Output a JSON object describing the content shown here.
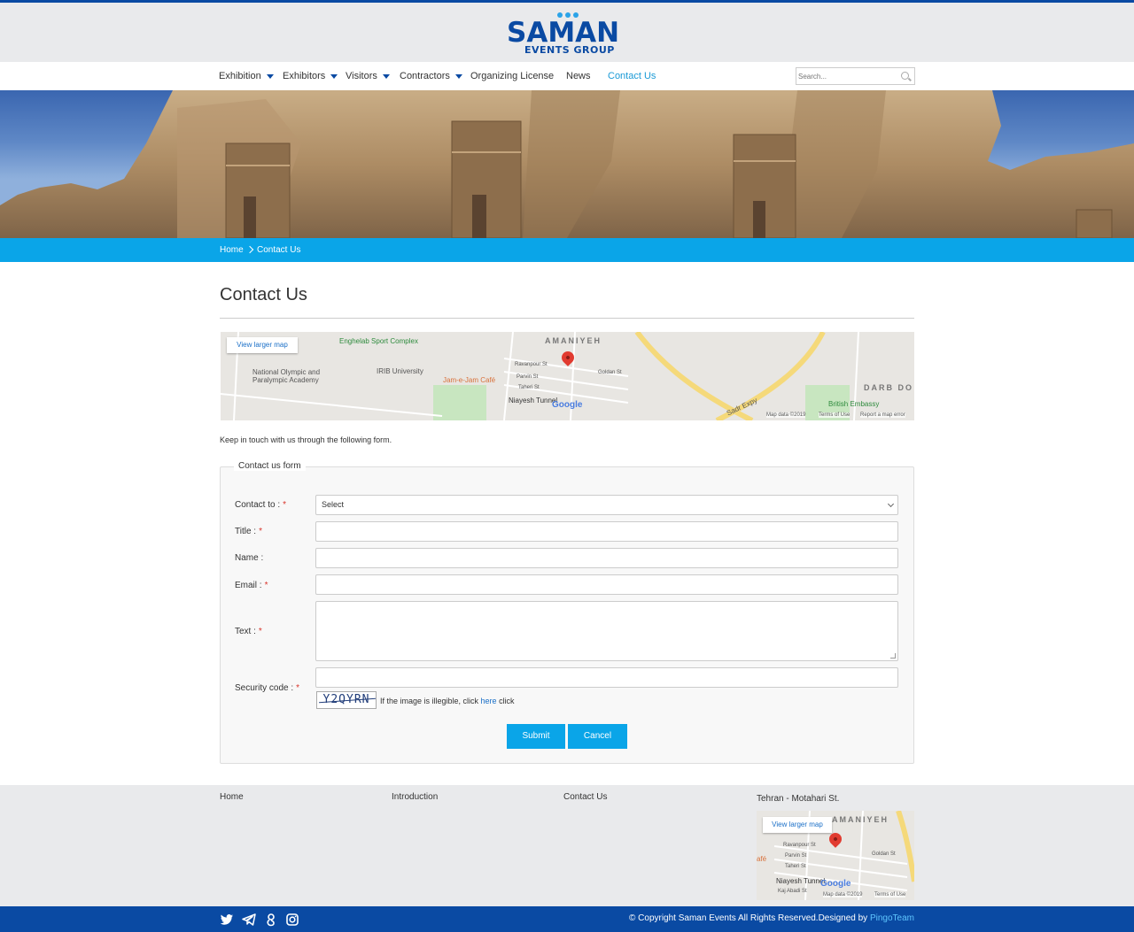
{
  "brand": {
    "name": "SAMAN",
    "sub": "EVENTS GROUP",
    "primary": "#0a4aa3",
    "accent": "#0aa5e8"
  },
  "nav": {
    "items": [
      {
        "label": "Exhibition"
      },
      {
        "label": "Exhibitors"
      },
      {
        "label": "Visitors"
      },
      {
        "label": "Contractors"
      },
      {
        "label": "Organizing License"
      },
      {
        "label": "News"
      },
      {
        "label": "Contact Us"
      }
    ],
    "search_placeholder": "Search..."
  },
  "breadcrumb": {
    "home": "Home",
    "current": "Contact Us"
  },
  "page": {
    "title": "Contact Us",
    "intro": "Keep in touch with us through the following form."
  },
  "map": {
    "larger_map": "View larger map",
    "labels": [
      "Enghelab Sport Complex",
      "AMANIYEH",
      "National Olympic and Paralympic Academy",
      "IRIB University",
      "Jam-e-Jam Café",
      "Niayesh Tunnel",
      "Sadr Expy",
      "DARB DO",
      "British Embassy",
      "Goldan St",
      "Parvin St",
      "Taheri St",
      "Ravanpour St"
    ],
    "google": "Google",
    "map_data": "Map data ©2019",
    "terms": "Terms of Use",
    "report": "Report a map error"
  },
  "form": {
    "legend": "Contact us form",
    "contact_to": {
      "label": "Contact to :",
      "value": "Select"
    },
    "title": {
      "label": "Title :"
    },
    "name": {
      "label": "Name :"
    },
    "email": {
      "label": "Email :"
    },
    "text": {
      "label": "Text :"
    },
    "security": {
      "label": "Security code :",
      "captcha": "Y2QYRN",
      "note_pre": "If the image is illegible, click ",
      "note_link": "here",
      "note_post": " click"
    },
    "required_mark": "*",
    "submit": "Submit",
    "cancel": "Cancel"
  },
  "footer": {
    "links": [
      "Home",
      "Introduction",
      "Contact Us"
    ],
    "address": "Tehran - Motahari St.",
    "map_labels": [
      "AMANIYEH",
      "Ravanpour St",
      "Parvin St",
      "Taheri St",
      "Goldan St",
      "Niayesh Tunnel",
      "Kaj Abadi St",
      "afé"
    ],
    "copyright": "© Copyright Saman Events All Rights Reserved.Designed by ",
    "designer": "PingoTeam",
    "social_icons": [
      "twitter-icon",
      "telegram-icon",
      "google-plus-icon",
      "instagram-icon"
    ]
  }
}
